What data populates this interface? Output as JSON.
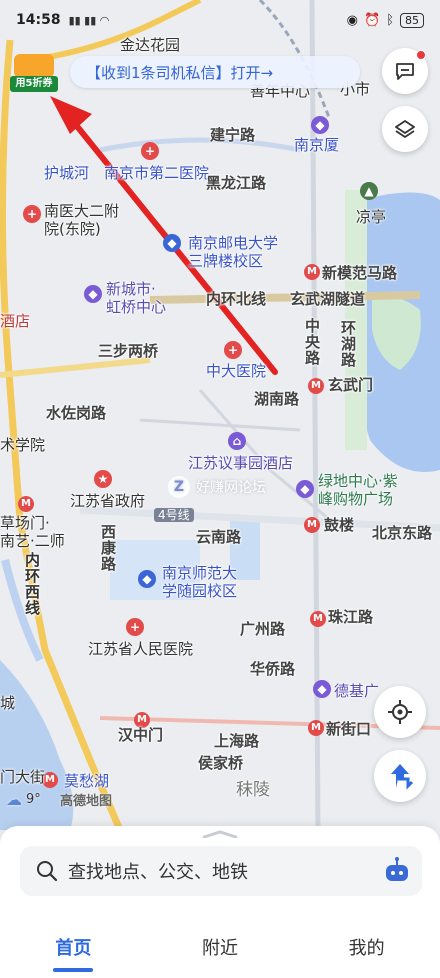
{
  "status_bar": {
    "time": "14:58",
    "battery": "85"
  },
  "notice": {
    "text": "【收到1条司机私信】打开→"
  },
  "promo": {
    "tag": "用5折券"
  },
  "map": {
    "labels": {
      "jindahuayuan": "金达花园",
      "xiaoshi": "小市",
      "tuochengzhong": "善年中心",
      "jianninglu": "建宁路",
      "nanjingdasha": "南京厦",
      "huchenghe": "护城河",
      "nanjing2yiyuan": "南京市第二医院",
      "heilongjianglu": "黑龙江路",
      "liangting": "凉亭",
      "nanyida2fu": "南医大二附",
      "nanyida2fu2": "院(东院)",
      "nanyouda": "南京邮电大学",
      "sanpailou": "三牌楼校区",
      "xinmofanmalu": "新模范马路",
      "xinchengshi": "新城市·",
      "hongqiao": "虹桥中心",
      "neihuanbeixian": "内环北线",
      "xuanwuhu": "玄武湖隧道",
      "jiudian": "酒店",
      "zhongyanglu": "中央路",
      "huanhulu": "环湖路",
      "sanbuliangqiao": "三步两桥",
      "zhongda": "中大医院",
      "xuanwumen": "玄武门",
      "hunanlu": "湖南路",
      "shuizuogang": "水佐岗路",
      "yishu": "术学院",
      "jiangsuyishi": "江苏议事园酒店",
      "lvdi": "绿地中心·紫",
      "feng": "峰购物广场",
      "jiangsushengzhengfu": "江苏省政府",
      "caochangmen": "草场门·",
      "nanyi2": "南艺·二师",
      "xikang": "西康路",
      "line4": "4号线",
      "yunnanlu": "云南路",
      "gulou": "鼓楼",
      "beijingdonglu": "北京东路",
      "neihuanxixian": "内环西线",
      "nanshi": "南京师范大",
      "suiyuan": "学随园校区",
      "zhujianglu": "珠江路",
      "guangzhoulu": "广州路",
      "jiangsurenmin": "江苏省人民医院",
      "huaqiaolu": "华侨路",
      "deji": "德基广",
      "hanzhongmen": "汉中门",
      "xinjiekou": "新街口",
      "shanghailu": "上海路",
      "houjiaqiao": "侯家桥",
      "moling": "秣陵",
      "cheng": "城",
      "mendajie": "门大街",
      "mochouhu": "莫愁湖"
    }
  },
  "weather": {
    "temp": "9°"
  },
  "watermark": {
    "logo": "高德地图",
    "forum": "好赚网论坛"
  },
  "search": {
    "placeholder": "查找地点、公交、地铁"
  },
  "tabs": [
    {
      "label": "首页",
      "active": true
    },
    {
      "label": "附近",
      "active": false
    },
    {
      "label": "我的",
      "active": false
    }
  ],
  "colors": {
    "accent": "#2f6ae0",
    "arrow": "#e32222",
    "water": "#a9c7f0",
    "park": "#cfe8d2"
  }
}
